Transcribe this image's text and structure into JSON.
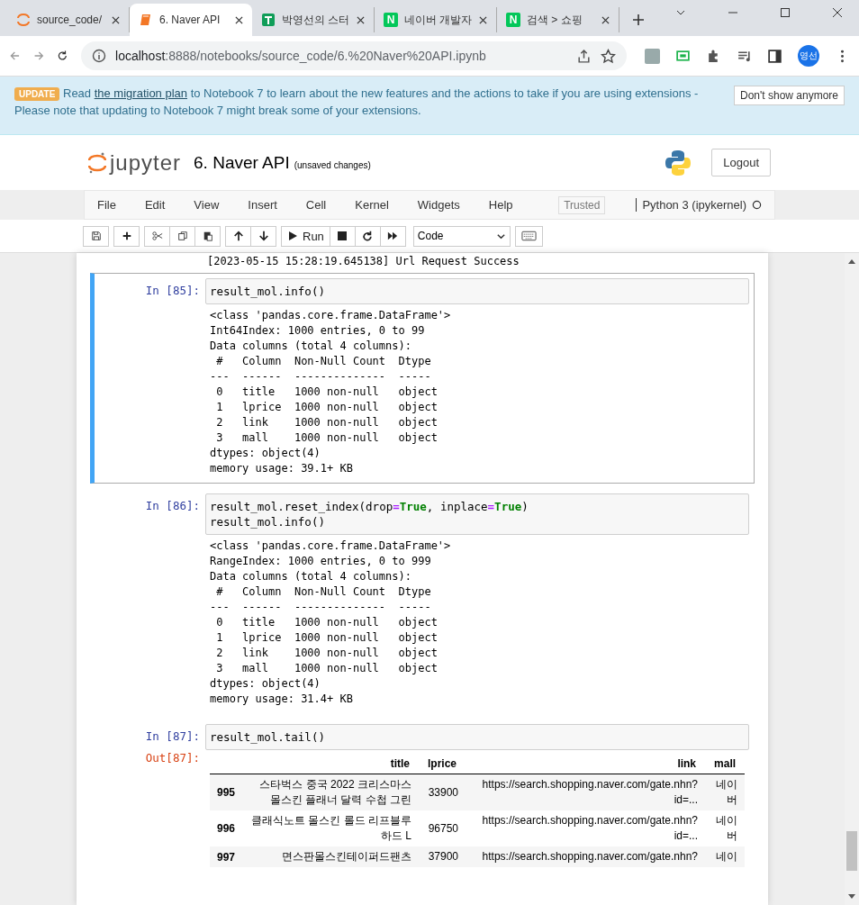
{
  "browser": {
    "tabs": [
      {
        "title": "source_code/",
        "kind": "jupyter",
        "selected": false
      },
      {
        "title": "6. Naver API",
        "kind": "notebook",
        "selected": true
      },
      {
        "title": "박영선의 스터",
        "kind": "sheet",
        "selected": false
      },
      {
        "title": "네이버 개발자",
        "kind": "naver",
        "icon_text": "N",
        "selected": false
      },
      {
        "title": "검색 > 쇼핑",
        "kind": "naver",
        "icon_text": "N",
        "selected": false
      }
    ],
    "url_host": "localhost",
    "url_rest": ":8888/notebooks/source_code/6.%20Naver%20API.ipynb",
    "profile": "영선"
  },
  "banner": {
    "badge": "UPDATE",
    "before": "Read ",
    "link": "the migration plan",
    "after": " to Notebook 7 to learn about the new features and the actions to take if you are using extensions - Please note that updating to Notebook 7 might break some of your extensions.",
    "button": "Don't show anymore"
  },
  "header": {
    "logo": "jupyter",
    "title": "6. Naver API",
    "status": "(unsaved changes)",
    "logout": "Logout"
  },
  "menu": [
    "File",
    "Edit",
    "View",
    "Insert",
    "Cell",
    "Kernel",
    "Widgets",
    "Help"
  ],
  "trusted": "Trusted",
  "kernel": "Python 3 (ipykernel)",
  "toolbar": {
    "run": "Run",
    "cell_type": "Code"
  },
  "prev_output": "[2023-05-15 15:28:19.645138] Url Request Success",
  "cells": [
    {
      "prompt": "In [85]:",
      "selected": true,
      "code": [
        [
          {
            "kind": "plain",
            "text": "result_mol.info()"
          }
        ]
      ],
      "output": "<class 'pandas.core.frame.DataFrame'>\nInt64Index: 1000 entries, 0 to 99\nData columns (total 4 columns):\n #   Column  Non-Null Count  Dtype \n---  ------  --------------  ----- \n 0   title   1000 non-null   object\n 1   lprice  1000 non-null   object\n 2   link    1000 non-null   object\n 3   mall    1000 non-null   object\ndtypes: object(4)\nmemory usage: 39.1+ KB"
    },
    {
      "prompt": "In [86]:",
      "selected": false,
      "code": [
        [
          {
            "kind": "plain",
            "text": "result_mol.reset_index(drop"
          },
          {
            "kind": "operator",
            "text": "="
          },
          {
            "kind": "keyword",
            "text": "True"
          },
          {
            "kind": "plain",
            "text": ", inplace"
          },
          {
            "kind": "operator",
            "text": "="
          },
          {
            "kind": "keyword",
            "text": "True"
          },
          {
            "kind": "plain",
            "text": ")"
          }
        ],
        [
          {
            "kind": "plain",
            "text": "result_mol.info()"
          }
        ]
      ],
      "output": "<class 'pandas.core.frame.DataFrame'>\nRangeIndex: 1000 entries, 0 to 999\nData columns (total 4 columns):\n #   Column  Non-Null Count  Dtype \n---  ------  --------------  ----- \n 0   title   1000 non-null   object\n 1   lprice  1000 non-null   object\n 2   link    1000 non-null   object\n 3   mall    1000 non-null   object\ndtypes: object(4)\nmemory usage: 31.4+ KB"
    },
    {
      "prompt": "In [87]:",
      "selected": false,
      "code": [
        [
          {
            "kind": "plain",
            "text": "result_mol.tail()"
          }
        ]
      ],
      "out_prompt": "Out[87]:",
      "table": {
        "columns": [
          "title",
          "lprice",
          "link",
          "mall"
        ],
        "rows": [
          {
            "index": "995",
            "title": "스타벅스 중국 2022 크리스마스 몰스킨 플래너 달력 수첩 그린",
            "lprice": "33900",
            "link": "https://search.shopping.naver.com/gate.nhn?id=...",
            "mall": "네이버"
          },
          {
            "index": "996",
            "title": "클래식노트 몰스킨 롤드 리프블루 하드 L",
            "lprice": "96750",
            "link": "https://search.shopping.naver.com/gate.nhn?id=...",
            "mall": "네이버"
          },
          {
            "index": "997",
            "title": "면스판몰스킨테이퍼드팬츠",
            "lprice": "37900",
            "link": "https://search.shopping.naver.com/gate.nhn?",
            "mall": "네이"
          }
        ]
      }
    }
  ]
}
